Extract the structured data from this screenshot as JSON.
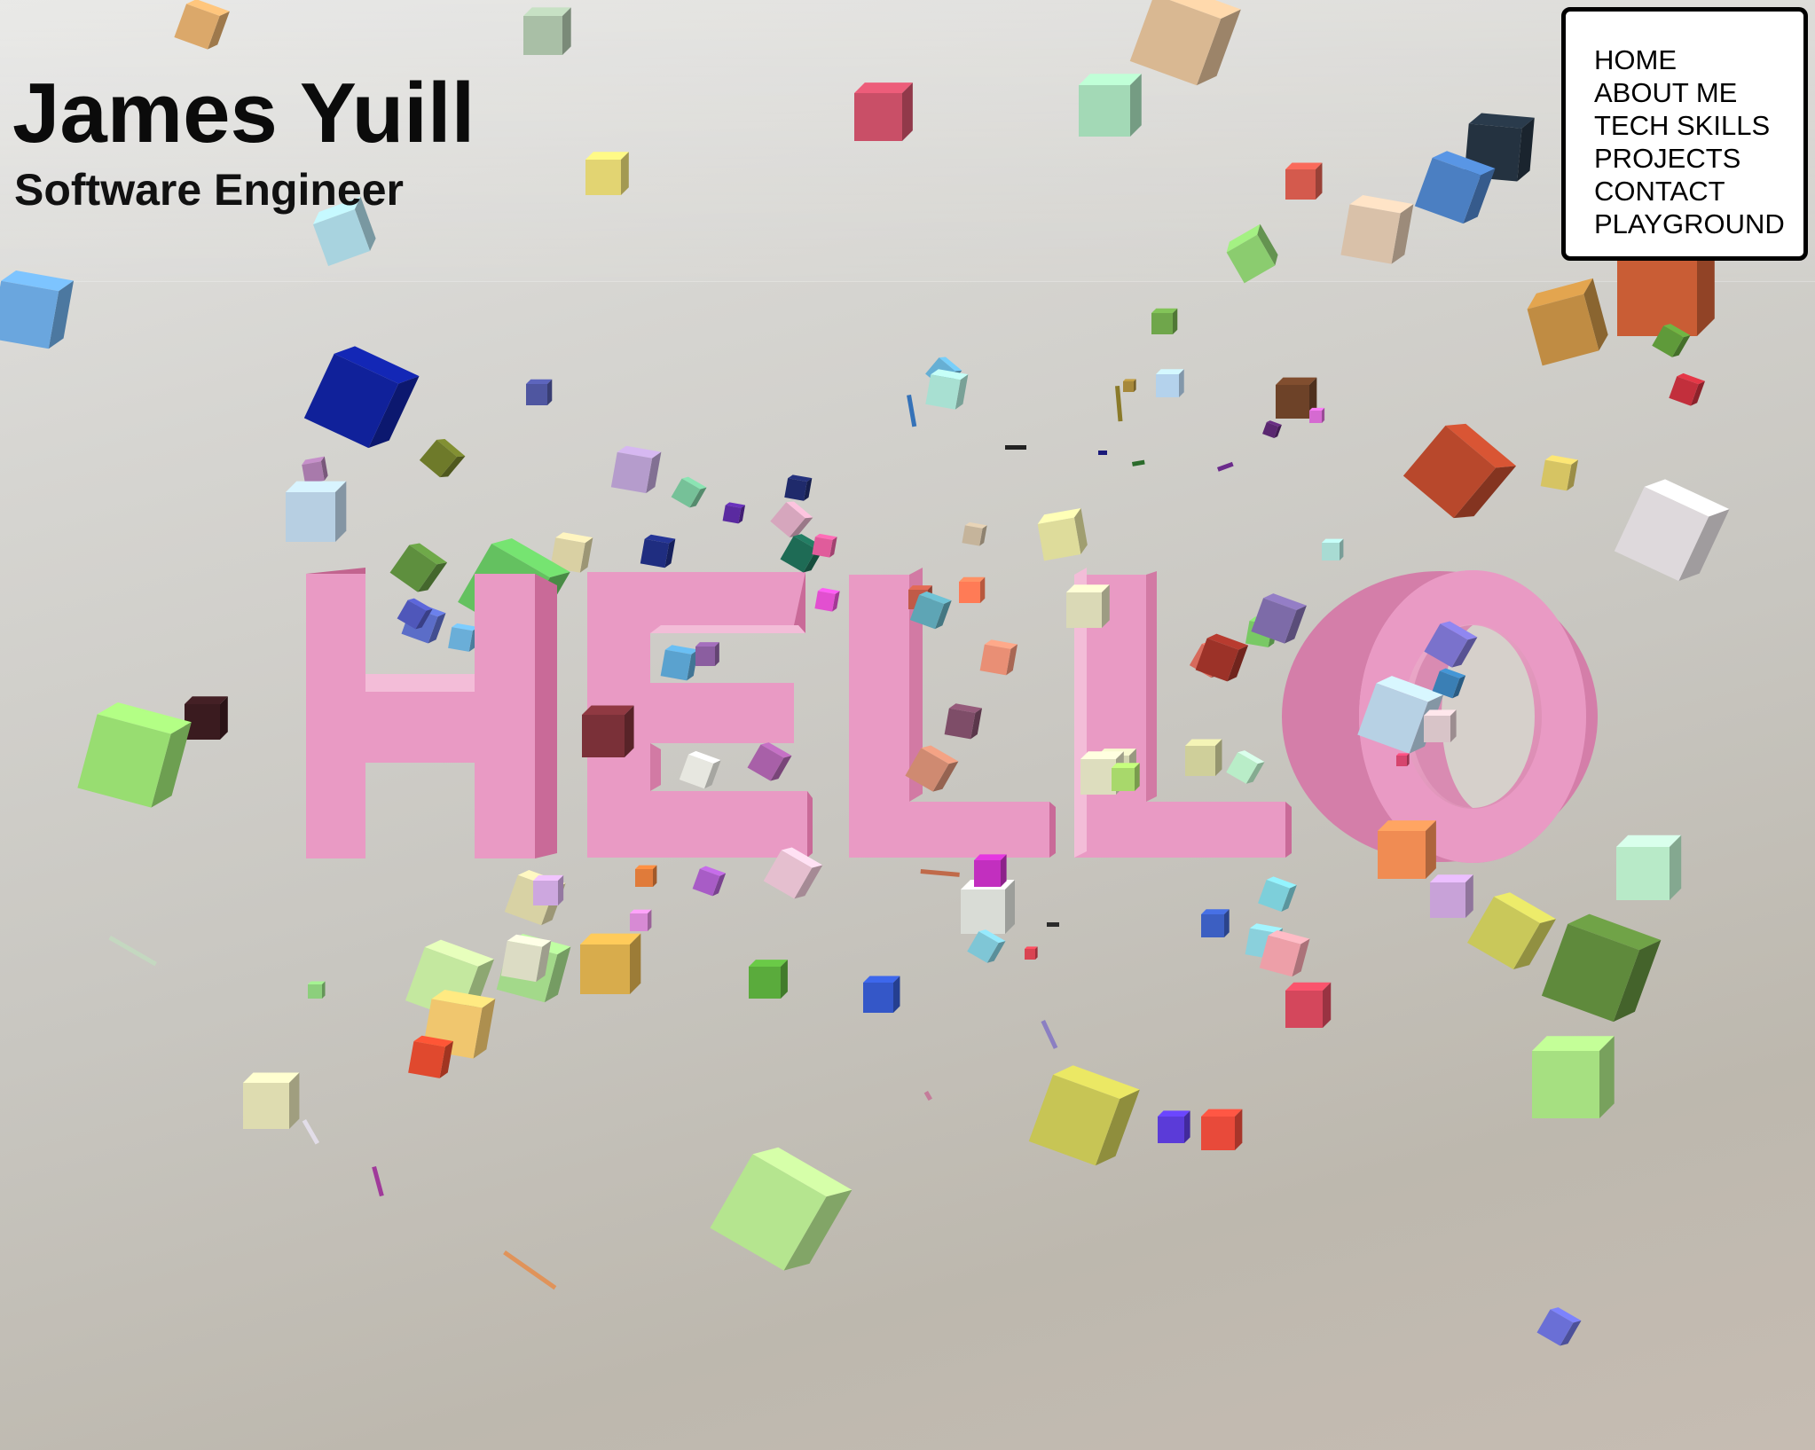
{
  "header": {
    "name": "James Yuill",
    "role": "Software Engineer"
  },
  "nav": {
    "items": [
      {
        "label": "HOME"
      },
      {
        "label": "ABOUT ME"
      },
      {
        "label": "TECH SKILLS"
      },
      {
        "label": "PROJECTS"
      },
      {
        "label": "CONTACT"
      },
      {
        "label": "PLAYGROUND"
      }
    ]
  },
  "scene": {
    "headline": "HELLO",
    "headline_color": "#e99ac4",
    "headline_side_color": "#c96a98"
  }
}
